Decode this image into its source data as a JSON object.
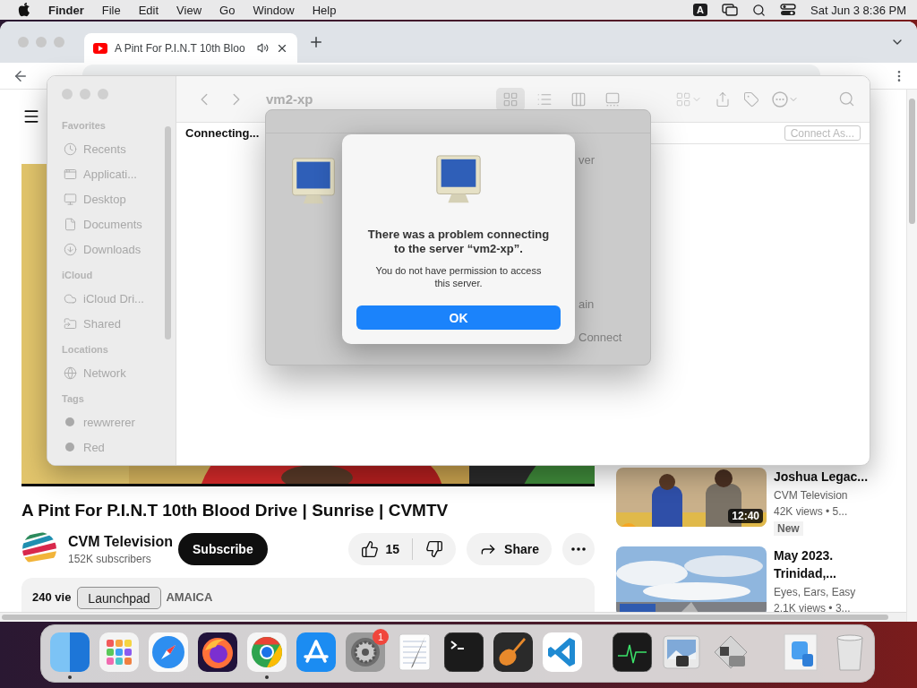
{
  "menu_bar": {
    "app": "Finder",
    "menus": [
      "File",
      "Edit",
      "View",
      "Go",
      "Window",
      "Help"
    ],
    "input_source": "A",
    "clock": "Sat Jun 3 8:36 PM"
  },
  "browser": {
    "tab": {
      "title": "A Pint For P.I.N.T 10th Bloo",
      "playing_audio": true,
      "selected": true
    }
  },
  "video": {
    "title": "A Pint For P.I.N.T 10th Blood Drive | Sunrise | CVMTV",
    "channel": "CVM Television",
    "subscribers": "152K subscribers",
    "subscribe": "Subscribe",
    "likes": "15",
    "share": "Share",
    "description_start": "240 vie",
    "description_end": "AMAICA"
  },
  "recommendations": [
    {
      "title": "Joshua Legac...",
      "channel": "CVM Television",
      "meta": "42K views  • 5...",
      "badge": "New",
      "duration": "12:40",
      "kind": "studio"
    },
    {
      "title": "May 2023. Trinidad,...",
      "channel": "Eyes, Ears, Easy",
      "meta": "2.1K views  • 3...",
      "kind": "sky"
    }
  ],
  "finder": {
    "title": "vm2-xp",
    "views": [
      {
        "kind": "icons",
        "selected": true
      },
      {
        "kind": "list",
        "selected": false
      },
      {
        "kind": "columns",
        "selected": false
      },
      {
        "kind": "gallery",
        "selected": false
      }
    ],
    "sidebar": [
      {
        "heading": "Favorites",
        "items": [
          {
            "label": "Recents",
            "kind": "recents"
          },
          {
            "label": "Applicati...",
            "kind": "applications"
          },
          {
            "label": "Desktop",
            "kind": "desktop"
          },
          {
            "label": "Documents",
            "kind": "documents"
          },
          {
            "label": "Downloads",
            "kind": "downloads"
          }
        ]
      },
      {
        "heading": "iCloud",
        "items": [
          {
            "label": "iCloud Dri...",
            "kind": "icloud"
          },
          {
            "label": "Shared",
            "kind": "shared"
          }
        ]
      },
      {
        "heading": "Locations",
        "items": [
          {
            "label": "Network",
            "kind": "network"
          }
        ]
      },
      {
        "heading": "Tags",
        "items": [
          {
            "label": "rewwrerer",
            "kind": "tag"
          },
          {
            "label": "Red",
            "kind": "tag"
          }
        ]
      }
    ],
    "status": "Connecting...",
    "connect_as": {
      "label": "Connect As...",
      "disabled": true
    }
  },
  "sheet": {
    "fragments": [
      "ver",
      "ain",
      "Connect"
    ]
  },
  "alert": {
    "title": "There was a problem connecting to the server “vm2-xp”.",
    "message": "You do not have permission to access this server.",
    "button": "OK"
  },
  "tooltip": "Launchpad",
  "dock": {
    "apps": [
      {
        "kind": "finder",
        "running": true
      },
      {
        "kind": "launchpad",
        "running": false
      },
      {
        "kind": "safari",
        "running": false
      },
      {
        "kind": "firefox",
        "running": false
      },
      {
        "kind": "chrome",
        "running": true
      },
      {
        "kind": "appstore",
        "running": false
      },
      {
        "kind": "settings",
        "running": false,
        "badge": "1"
      },
      {
        "kind": "textedit",
        "running": false
      },
      {
        "kind": "terminal",
        "running": false
      },
      {
        "kind": "garageband",
        "running": false
      },
      {
        "kind": "vscode",
        "running": false
      }
    ],
    "utilities": [
      {
        "kind": "activity",
        "running": false
      },
      {
        "kind": "preview",
        "running": false
      },
      {
        "kind": "bootcamp",
        "running": false
      }
    ],
    "stacks": [
      {
        "kind": "downloads"
      },
      {
        "kind": "trash"
      }
    ]
  }
}
